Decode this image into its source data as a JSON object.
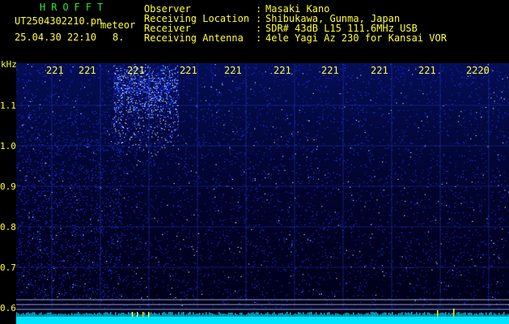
{
  "header": {
    "app_name": "HROFFT",
    "filename": "UT2504302210.pn",
    "type": "meteor",
    "datetime": "25.04.30 22:10",
    "count": "8.",
    "info": [
      {
        "label": "Observer",
        "value": "Masaki Kano"
      },
      {
        "label": "Receiving Location",
        "value": "Shibukawa, Gunma, Japan"
      },
      {
        "label": "Receiver",
        "value": "SDR# 43dB L15 111.6MHz USB"
      },
      {
        "label": "Receiving Antenna",
        "value": "4ele Yagi Az 230 for Kansai VOR"
      }
    ],
    "separator": ":"
  },
  "spectrogram": {
    "x_unit": "",
    "y_unit": "kHz",
    "freq_ticks": [
      "221",
      "221",
      "221",
      "221",
      "221",
      "221",
      "221",
      "221",
      "221",
      "2220"
    ],
    "y_ticks": [
      "1.1",
      "1.0",
      "0.9",
      "0.8",
      "0.7",
      "0.6"
    ],
    "colors": {
      "background": "#00001a",
      "noise": "#1a3aff",
      "bright": "#aaccff",
      "baseline": "#00e5ff",
      "text": "#ffff33",
      "marker": "#ffff33"
    }
  }
}
